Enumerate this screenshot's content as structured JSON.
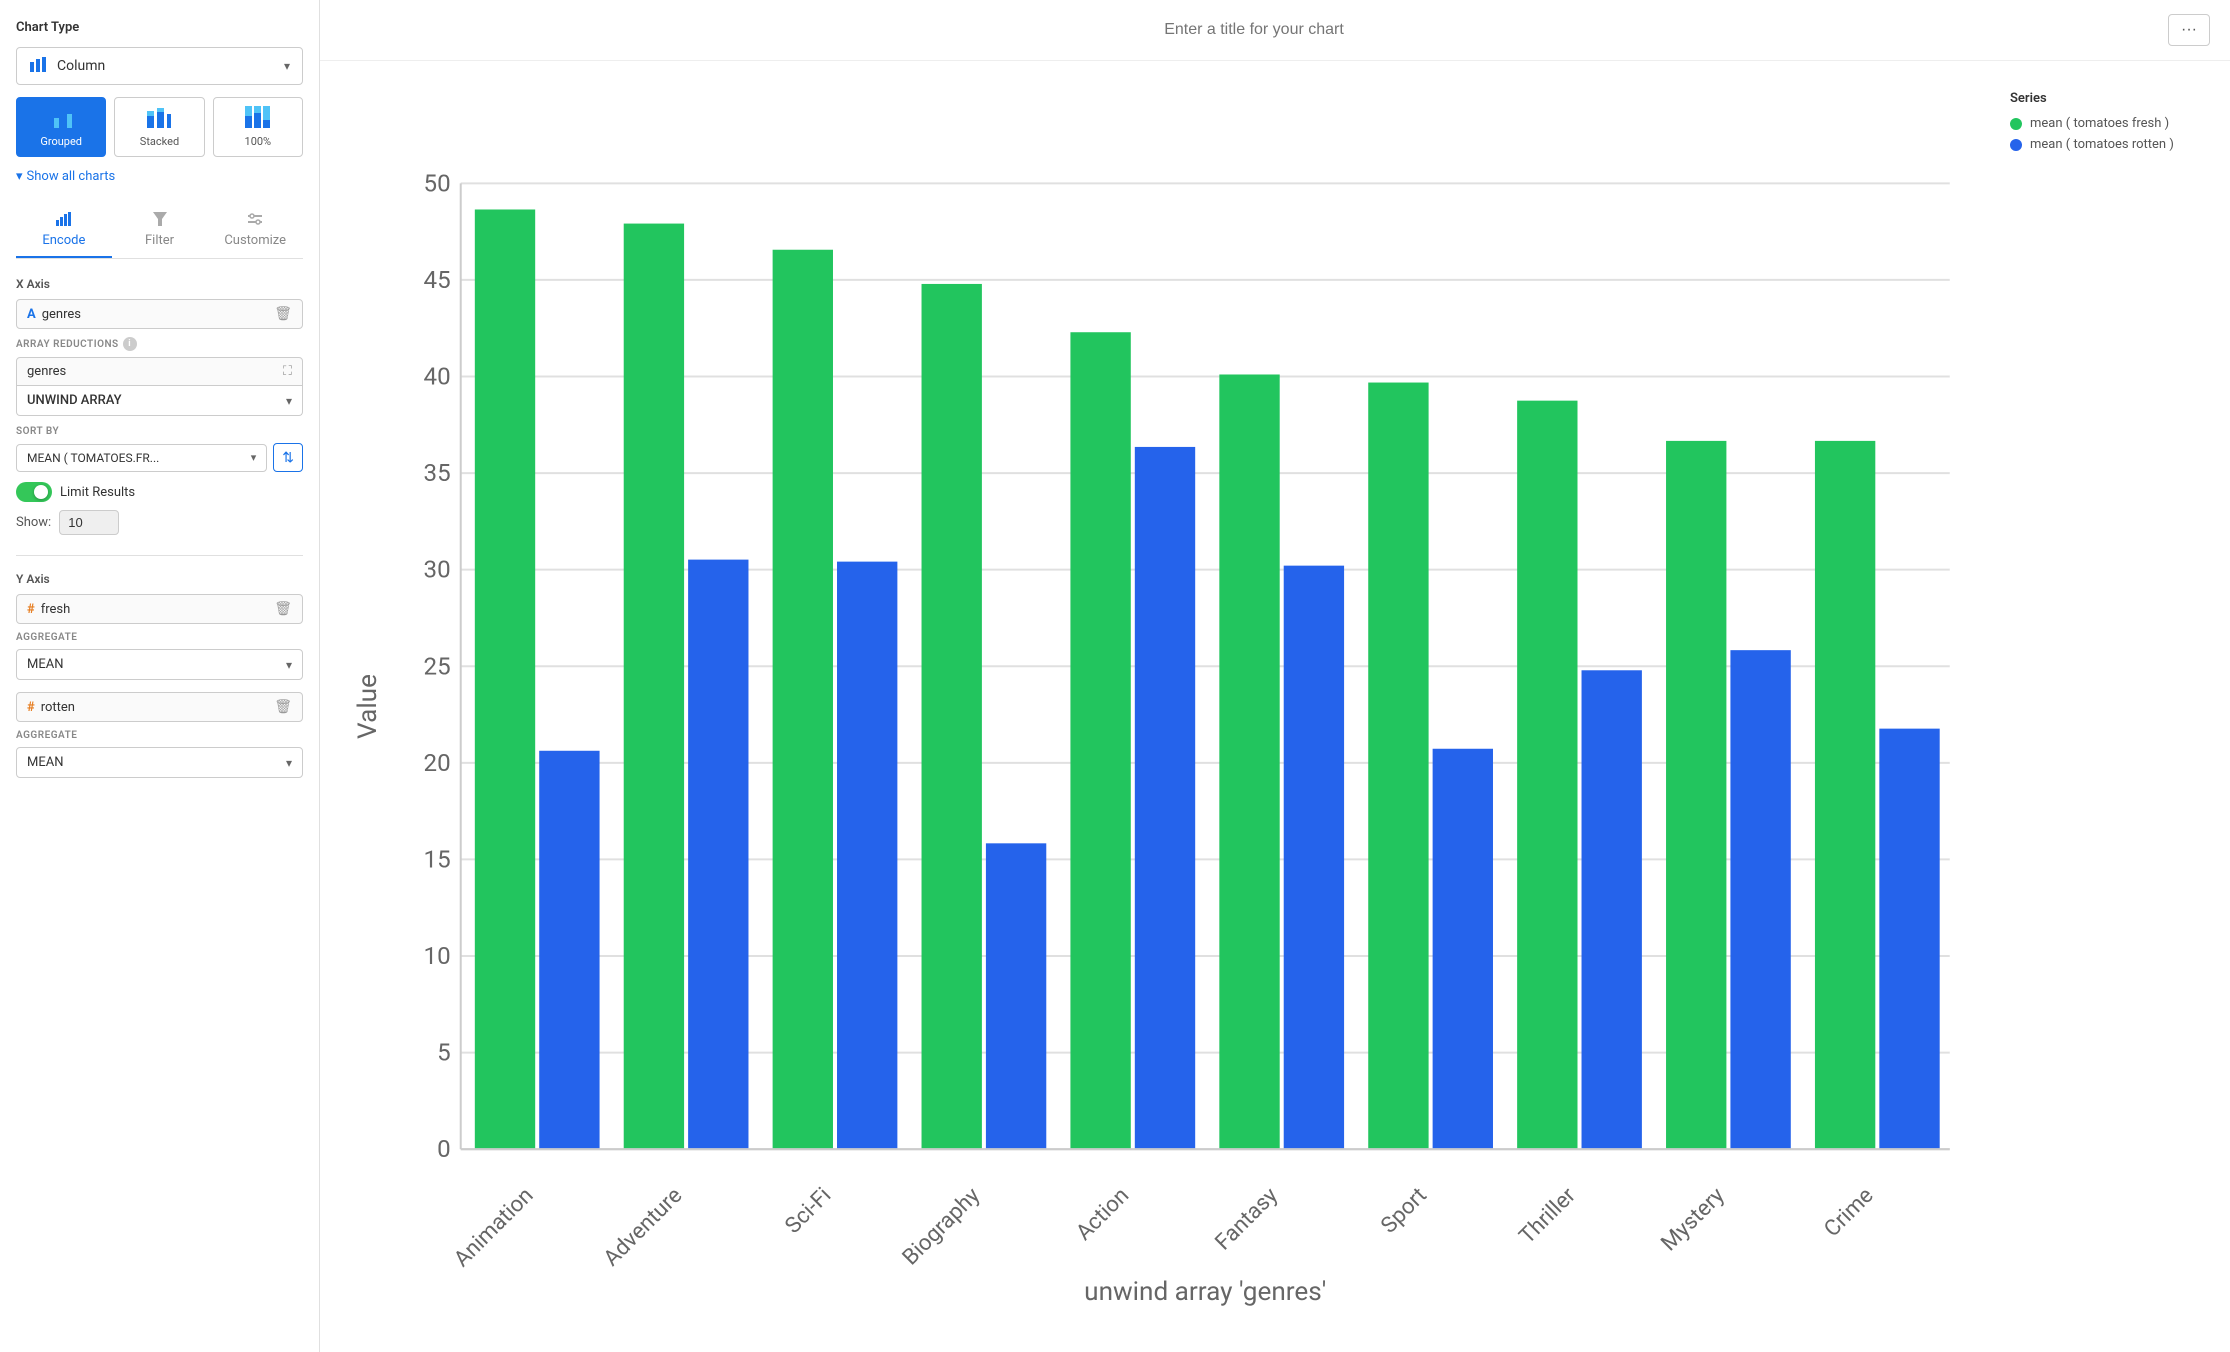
{
  "sidebar": {
    "chart_type_section": "Chart Type",
    "chart_type_selected": "Column",
    "chart_type_options": [
      {
        "id": "grouped",
        "label": "Grouped",
        "active": true
      },
      {
        "id": "stacked",
        "label": "Stacked",
        "active": false
      },
      {
        "id": "100pct",
        "label": "100%",
        "active": false
      }
    ],
    "show_all_charts": "Show all charts",
    "tabs": [
      {
        "id": "encode",
        "label": "Encode",
        "active": true
      },
      {
        "id": "filter",
        "label": "Filter",
        "active": false
      },
      {
        "id": "customize",
        "label": "Customize",
        "active": false
      }
    ],
    "x_axis_label": "X Axis",
    "x_field": "genres",
    "x_field_type": "A",
    "array_reductions_label": "ARRAY REDUCTIONS",
    "array_field_genres": "genres",
    "unwind_array_label": "UNWIND ARRAY",
    "sort_by_label": "SORT BY",
    "sort_field": "MEAN ( TOMATOES.FR...",
    "limit_label": "Limit Results",
    "show_label": "Show:",
    "show_value": "10",
    "y_axis_label": "Y Axis",
    "y_field_fresh": "fresh",
    "y_field_rotten": "rotten",
    "y_field_type": "#",
    "aggregate_label": "AGGREGATE",
    "aggregate_value": "MEAN"
  },
  "chart": {
    "title_placeholder": "Enter a title for your chart",
    "x_axis_title": "unwind array 'genres'",
    "y_axis_title": "Value",
    "series": [
      {
        "label": "mean ( tomatoes fresh )",
        "color": "#22c55e"
      },
      {
        "label": "mean ( tomatoes rotten )",
        "color": "#2563eb"
      }
    ],
    "categories": [
      "Animation",
      "Adventure",
      "Sci-Fi",
      "Biography",
      "Action",
      "Fantasy",
      "Sport",
      "Thriller",
      "Mystery",
      "Crime"
    ],
    "data": {
      "fresh": [
        48.5,
        47.8,
        46.5,
        44.8,
        42.3,
        40.2,
        39.7,
        38.7,
        36.7,
        36.7
      ],
      "rotten": [
        20.6,
        30.6,
        30.4,
        15.9,
        36.4,
        30.2,
        20.8,
        24.8,
        25.8,
        21.8
      ]
    },
    "y_max": 50,
    "y_min": 0,
    "y_ticks": [
      0,
      5,
      10,
      15,
      20,
      25,
      30,
      35,
      40,
      45,
      50
    ]
  }
}
